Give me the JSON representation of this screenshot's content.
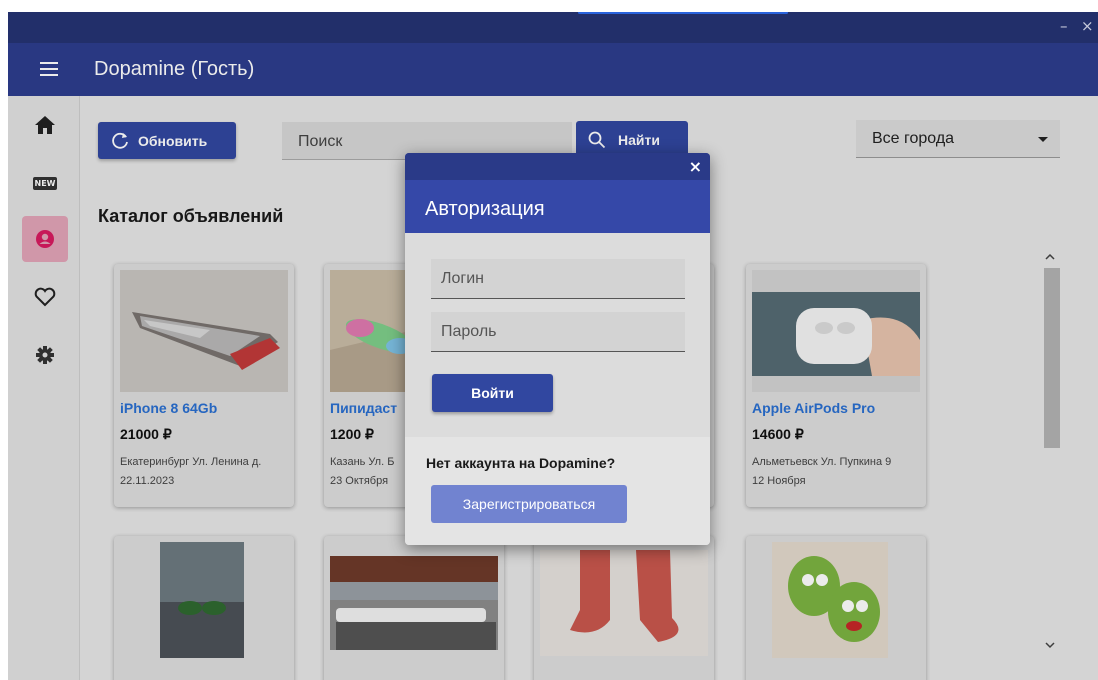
{
  "window": {
    "minimize": "–",
    "close": "×"
  },
  "appbar": {
    "title": "Dopamine (Гость)"
  },
  "rail": {
    "new_badge": "NEW"
  },
  "toolbar": {
    "refresh_label": "Обновить",
    "search_placeholder": "Поиск",
    "find_label": "Найти",
    "city_selected": "Все города"
  },
  "catalog": {
    "title": "Каталог объявлений",
    "cards": [
      {
        "title": "iPhone 8 64Gb",
        "price": "21000 ₽",
        "address": "Екатеринбург Ул. Ленина д.",
        "date": "22.11.2023"
      },
      {
        "title": "Пипидаст",
        "price": "1200 ₽",
        "address": "Казань Ул. Б",
        "date": "23 Октября"
      },
      {
        "title": "Apple AirPods Pro",
        "price": "14600 ₽",
        "address": "Альметьевск Ул. Пупкина 9",
        "date": "12 Ноября"
      }
    ]
  },
  "modal": {
    "title": "Авторизация",
    "close": "×",
    "login_placeholder": "Логин",
    "password_placeholder": "Пароль",
    "login_button": "Войти",
    "no_account": "Нет аккаунта на Dopamine?",
    "register_button": "Зарегистрироваться"
  },
  "colors": {
    "appbar": "#2d3d8e",
    "accent": "#3147a0",
    "link": "#2a6fd1",
    "active_rail": "#e2a4b8"
  }
}
